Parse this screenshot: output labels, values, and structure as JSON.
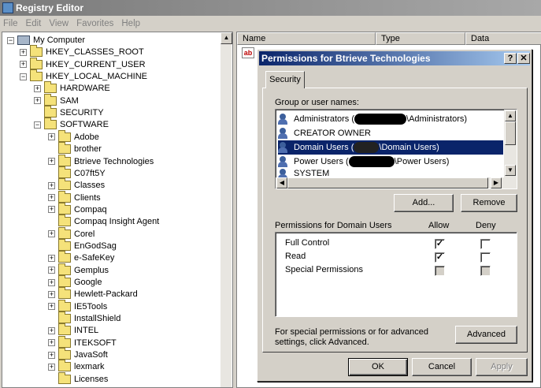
{
  "window": {
    "title": "Registry Editor"
  },
  "menu": [
    "File",
    "Edit",
    "View",
    "Favorites",
    "Help"
  ],
  "tree": [
    {
      "label": "My Computer",
      "depth": 0,
      "expander": "−",
      "icon": "computer-icon"
    },
    {
      "label": "HKEY_CLASSES_ROOT",
      "depth": 1,
      "expander": "+",
      "icon": "folder-icon"
    },
    {
      "label": "HKEY_CURRENT_USER",
      "depth": 1,
      "expander": "+",
      "icon": "folder-icon"
    },
    {
      "label": "HKEY_LOCAL_MACHINE",
      "depth": 1,
      "expander": "−",
      "icon": "folder-icon"
    },
    {
      "label": "HARDWARE",
      "depth": 2,
      "expander": "+",
      "icon": "folder-icon"
    },
    {
      "label": "SAM",
      "depth": 2,
      "expander": "+",
      "icon": "folder-icon"
    },
    {
      "label": "SECURITY",
      "depth": 2,
      "expander": "",
      "icon": "folder-icon"
    },
    {
      "label": "SOFTWARE",
      "depth": 2,
      "expander": "−",
      "icon": "folder-icon"
    },
    {
      "label": "Adobe",
      "depth": 3,
      "expander": "+",
      "icon": "folder-icon"
    },
    {
      "label": "brother",
      "depth": 3,
      "expander": "",
      "icon": "folder-icon"
    },
    {
      "label": "Btrieve Technologies",
      "depth": 3,
      "expander": "+",
      "icon": "folder-open-icon"
    },
    {
      "label": "C07ft5Y",
      "depth": 3,
      "expander": "",
      "icon": "folder-icon"
    },
    {
      "label": "Classes",
      "depth": 3,
      "expander": "+",
      "icon": "folder-icon"
    },
    {
      "label": "Clients",
      "depth": 3,
      "expander": "+",
      "icon": "folder-icon"
    },
    {
      "label": "Compaq",
      "depth": 3,
      "expander": "+",
      "icon": "folder-icon"
    },
    {
      "label": "Compaq Insight Agent",
      "depth": 3,
      "expander": "",
      "icon": "folder-icon"
    },
    {
      "label": "Corel",
      "depth": 3,
      "expander": "+",
      "icon": "folder-icon"
    },
    {
      "label": "EnGodSag",
      "depth": 3,
      "expander": "",
      "icon": "folder-icon"
    },
    {
      "label": "e-SafeKey",
      "depth": 3,
      "expander": "+",
      "icon": "folder-icon"
    },
    {
      "label": "Gemplus",
      "depth": 3,
      "expander": "+",
      "icon": "folder-icon"
    },
    {
      "label": "Google",
      "depth": 3,
      "expander": "+",
      "icon": "folder-icon"
    },
    {
      "label": "Hewlett-Packard",
      "depth": 3,
      "expander": "+",
      "icon": "folder-icon"
    },
    {
      "label": "IE5Tools",
      "depth": 3,
      "expander": "+",
      "icon": "folder-icon"
    },
    {
      "label": "InstallShield",
      "depth": 3,
      "expander": "",
      "icon": "folder-icon"
    },
    {
      "label": "INTEL",
      "depth": 3,
      "expander": "+",
      "icon": "folder-icon"
    },
    {
      "label": "ITEKSOFT",
      "depth": 3,
      "expander": "+",
      "icon": "folder-icon"
    },
    {
      "label": "JavaSoft",
      "depth": 3,
      "expander": "+",
      "icon": "folder-icon"
    },
    {
      "label": "lexmark",
      "depth": 3,
      "expander": "+",
      "icon": "folder-icon"
    },
    {
      "label": "Licenses",
      "depth": 3,
      "expander": "",
      "icon": "folder-icon"
    }
  ],
  "list": {
    "columns": [
      "Name",
      "Type",
      "Data"
    ]
  },
  "dialog": {
    "title": "Permissions for Btrieve Technologies",
    "help_btn": "?",
    "close_btn": "✕",
    "tab": "Security",
    "group_label": "Group or user names:",
    "users": [
      {
        "prefix": "Administrators (",
        "suffix": "\\Administrators)"
      },
      {
        "prefix": "CREATOR OWNER",
        "suffix": ""
      },
      {
        "prefix": "Domain Users (",
        "suffix": "\\Domain Users)"
      },
      {
        "prefix": "Power Users (",
        "suffix": "\\Power Users)"
      },
      {
        "prefix": "SYSTEM",
        "suffix": ""
      }
    ],
    "add_btn": "Add...",
    "remove_btn": "Remove",
    "perm_label": "Permissions for Domain Users",
    "allow_col": "Allow",
    "deny_col": "Deny",
    "permissions": [
      {
        "name": "Full Control",
        "allow": "✓",
        "deny": ""
      },
      {
        "name": "Read",
        "allow": "✓",
        "deny": ""
      },
      {
        "name": "Special Permissions",
        "allow": "",
        "deny": ""
      }
    ],
    "advanced_text": "For special permissions or for advanced settings, click Advanced.",
    "advanced_btn": "Advanced",
    "ok_btn": "OK",
    "cancel_btn": "Cancel",
    "apply_btn": "Apply"
  }
}
